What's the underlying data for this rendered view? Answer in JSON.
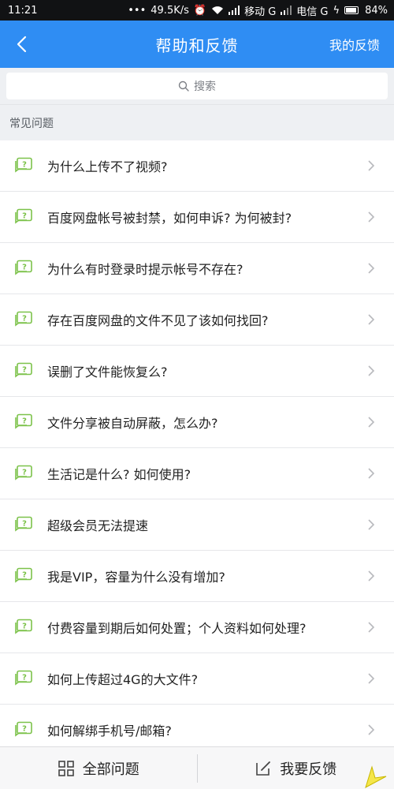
{
  "status_bar": {
    "time": "11:21",
    "speed": "49.5K/s",
    "carrier1": "移动 G",
    "carrier2": "电信 G",
    "battery": "84%"
  },
  "app_bar": {
    "title": "帮助和反馈",
    "right_action": "我的反馈"
  },
  "search": {
    "placeholder": "搜索"
  },
  "section": {
    "title": "常见问题"
  },
  "faq_items": [
    {
      "label": "为什么上传不了视频?"
    },
    {
      "label": "百度网盘帐号被封禁，如何申诉? 为何被封?"
    },
    {
      "label": "为什么有时登录时提示帐号不存在?"
    },
    {
      "label": "存在百度网盘的文件不见了该如何找回?"
    },
    {
      "label": "误删了文件能恢复么?"
    },
    {
      "label": "文件分享被自动屏蔽，怎么办?"
    },
    {
      "label": "生活记是什么? 如何使用?"
    },
    {
      "label": "超级会员无法提速"
    },
    {
      "label": "我是VIP，容量为什么没有增加?"
    },
    {
      "label": "付费容量到期后如何处置；个人资料如何处理?"
    },
    {
      "label": "如何上传超过4G的大文件?"
    },
    {
      "label": "如何解绑手机号/邮箱?"
    }
  ],
  "bottom_bar": {
    "all_questions": "全部问题",
    "submit_feedback": "我要反馈"
  },
  "colors": {
    "accent": "#2f8df3",
    "icon_green": "#7cc24a"
  }
}
